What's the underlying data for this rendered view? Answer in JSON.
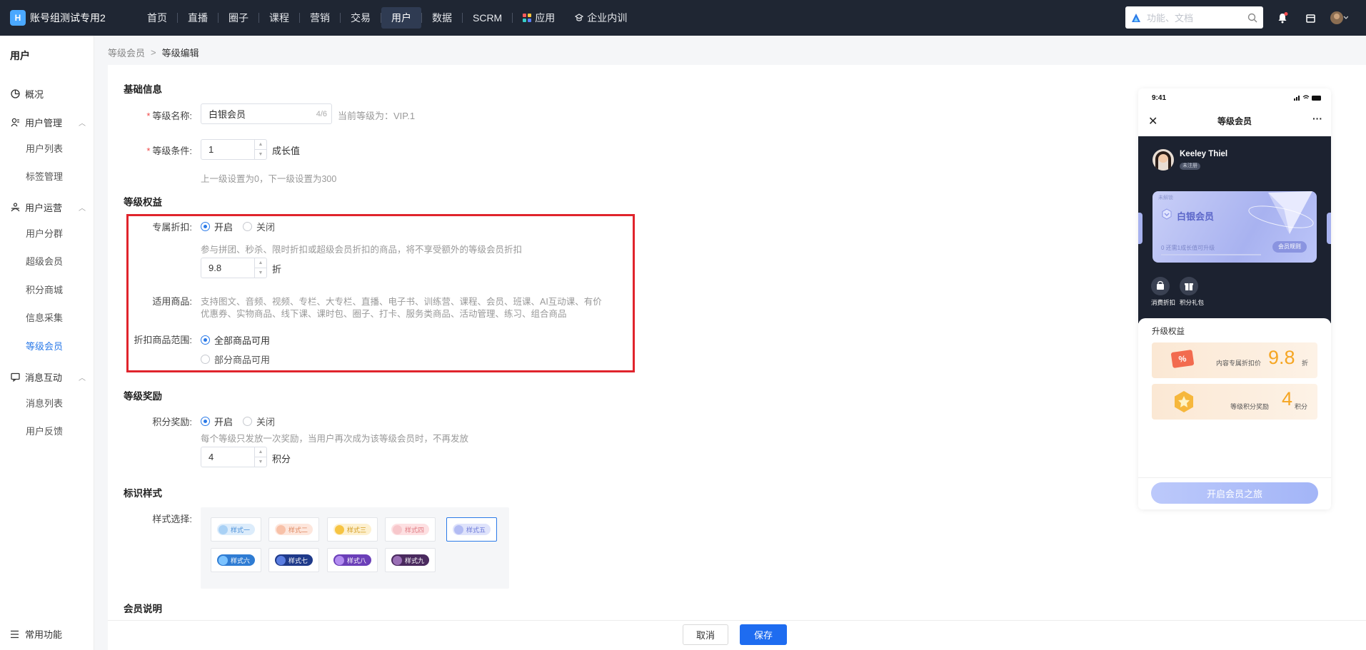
{
  "app": {
    "name": "账号组测试专用2",
    "logo_text": "H"
  },
  "nav": {
    "items": [
      {
        "label": "首页"
      },
      {
        "label": "直播"
      },
      {
        "label": "圈子"
      },
      {
        "label": "课程"
      },
      {
        "label": "营销"
      },
      {
        "label": "交易"
      },
      {
        "label": "用户",
        "active": true
      },
      {
        "label": "数据"
      },
      {
        "label": "SCRM"
      },
      {
        "label": "应用",
        "icon": "grid-icon"
      },
      {
        "label": "企业内训",
        "icon": "training-icon"
      }
    ]
  },
  "search": {
    "placeholder": "功能、文档"
  },
  "sidebar": {
    "title": "用户",
    "overview": "概况",
    "group_user_mgmt": "用户管理",
    "user_list": "用户列表",
    "tag_mgmt": "标签管理",
    "group_user_ops": "用户运营",
    "user_segment": "用户分群",
    "super_member": "超级会员",
    "points_mall": "积分商城",
    "info_collect": "信息采集",
    "level_member": "等级会员",
    "group_message": "消息互动",
    "message_list": "消息列表",
    "user_feedback": "用户反馈",
    "common": "常用功能"
  },
  "breadcrumb": {
    "parent": "等级会员",
    "current": "等级编辑",
    "separator": ">"
  },
  "form": {
    "basic_title": "基础信息",
    "name_label": "等级名称:",
    "name_value": "白银会员",
    "name_count": "4/6",
    "current_level": "当前等级为：VIP.1",
    "cond_label": "等级条件:",
    "cond_value": "1",
    "cond_unit": "成长值",
    "cond_hint": "上一级设置为0，下一级设置为300",
    "rights_title": "等级权益",
    "discount_label": "专属折扣:",
    "on": "开启",
    "off": "关闭",
    "discount_hint": "参与拼团、秒杀、限时折扣或超级会员折扣的商品，将不享受额外的等级会员折扣",
    "discount_value": "9.8",
    "discount_unit": "折",
    "goods_label": "适用商品:",
    "goods_line1": "支持图文、音频、视频、专栏、大专栏、直播、电子书、训练营、课程、会员、班课、AI互动课、有价",
    "goods_line2": "优惠券、实物商品、线下课、课时包、圈子、打卡、服务类商品、活动管理、练习、组合商品",
    "scope_label": "折扣商品范围:",
    "scope_all": "全部商品可用",
    "scope_part": "部分商品可用",
    "reward_title": "等级奖励",
    "points_label": "积分奖励:",
    "points_hint": "每个等级只发放一次奖励，当用户再次成为该等级会员时，不再发放",
    "points_value": "4",
    "points_unit": "积分",
    "style_title": "标识样式",
    "style_label": "样式选择:",
    "styles": [
      "样式一",
      "样式二",
      "样式三",
      "样式四",
      "样式五",
      "样式六",
      "样式七",
      "样式八",
      "样式九"
    ],
    "member_desc_title": "会员说明"
  },
  "footer": {
    "cancel": "取消",
    "save": "保存"
  },
  "phone": {
    "time": "9:41",
    "title": "等级会员",
    "user_name": "Keeley Thiel",
    "user_tag": "未注册",
    "card_small": "未解锁",
    "card_level": "白银会员",
    "card_progress": "0 还需1成长值可升级",
    "card_rule": "会员规则",
    "icon1": "消费折扣",
    "icon2": "积分礼包",
    "perks_title": "升级权益",
    "perk1_label": "内容专属折扣价",
    "perk1_value": "9.8",
    "perk1_unit": "折",
    "perk2_label": "等级积分奖励",
    "perk2_value": "4",
    "perk2_unit": "积分",
    "cta": "开启会员之旅"
  },
  "colors": {
    "accent": "#2b7ae8",
    "topbar": "#1f2633",
    "highlight_box": "#e0242c",
    "save_button": "#1e6cf0"
  }
}
